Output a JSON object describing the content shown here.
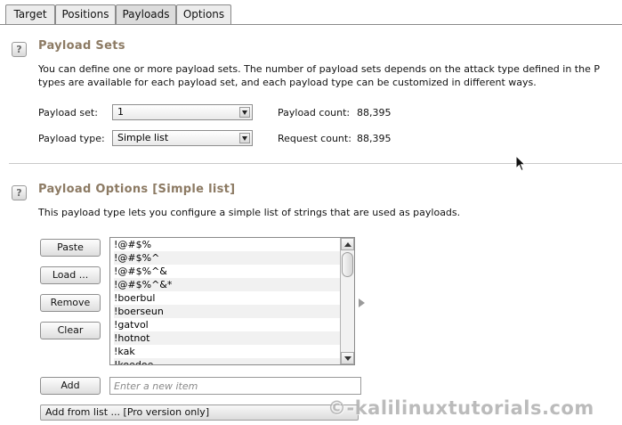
{
  "tabs": [
    "Target",
    "Positions",
    "Payloads",
    "Options"
  ],
  "active_tab": "Payloads",
  "payload_sets": {
    "help_glyph": "?",
    "title": "Payload Sets",
    "description_line1": "You can define one or more payload sets. The number of payload sets depends on the attack type defined in the P",
    "description_line2": "types are available for each payload set, and each payload type can be customized in different ways.",
    "payload_set_label": "Payload set:",
    "payload_set_value": "1",
    "payload_type_label": "Payload type:",
    "payload_type_value": "Simple list",
    "payload_count_label": "Payload count:",
    "payload_count_value": "88,395",
    "request_count_label": "Request count:",
    "request_count_value": "88,395"
  },
  "payload_options": {
    "help_glyph": "?",
    "title": "Payload Options [Simple list]",
    "description": "This payload type lets you configure a simple list of strings that are used as payloads.",
    "buttons": {
      "paste": "Paste",
      "load": "Load ...",
      "remove": "Remove",
      "clear": "Clear",
      "add": "Add"
    },
    "list_items": [
      "!@#$%",
      "!@#$%^",
      "!@#$%^&",
      "!@#$%^&*",
      "!boerbul",
      "!boerseun",
      "!gatvol",
      "!hotnot",
      "!kak",
      "!koedoe"
    ],
    "new_item_placeholder": "Enter a new item",
    "add_from_list": "Add from list ... [Pro version only]"
  },
  "watermark": "©-kalilinuxtutorials.com",
  "colors": {
    "section_title": "#8c7a63",
    "tab_active": "#dcdcdc",
    "list_alt_row": "#f1f1f1"
  },
  "icons": {
    "help": "help-icon",
    "dropdown": "chevron-down-icon",
    "cursor": "mouse-pointer-icon"
  }
}
